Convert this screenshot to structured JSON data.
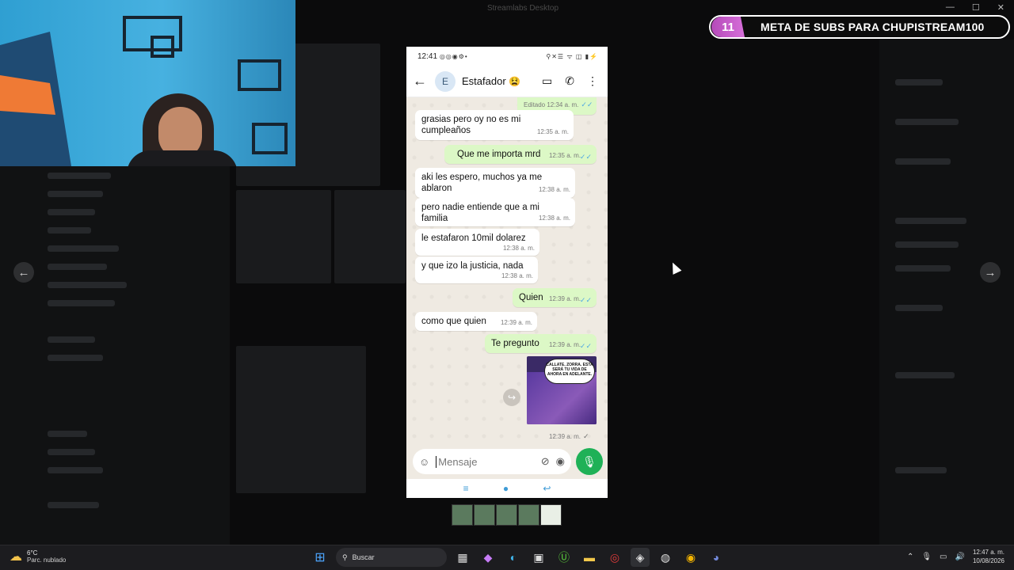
{
  "window": {
    "title": "Streamlabs Desktop",
    "min": "—",
    "max": "☐",
    "close": "✕"
  },
  "overlay": {
    "subs_count": "11",
    "subs_label": "META DE SUBS PARA CHUPISTREAM100"
  },
  "nav": {
    "prev": "←",
    "next": "→"
  },
  "phone": {
    "status": {
      "time": "12:41",
      "left_icons": "◎◎◉⚙•",
      "right_icons": "⚲✕☰ ᯤ ◫ ▮⚡"
    },
    "header": {
      "back": "←",
      "avatar_letter": "E",
      "contact_name": "Estafador",
      "contact_emoji": "😫",
      "video": "▭",
      "call": "✆",
      "menu": "⋮"
    },
    "messages": [
      {
        "dir": "out",
        "text": "",
        "time": "Editado 12:34 a. m.",
        "ticks": "✓✓"
      },
      {
        "dir": "in",
        "text": "grasias pero oy no es mi cumpleaños",
        "time": "12:35 a. m."
      },
      {
        "dir": "out",
        "text": "Que me importa mrd",
        "time": "12:35 a. m.",
        "ticks": "✓✓"
      },
      {
        "dir": "in",
        "text": "aki les espero, muchos ya me ablaron",
        "time": "12:38 a. m."
      },
      {
        "dir": "in",
        "text": "pero nadie entiende que a mi familia",
        "time": "12:38 a. m."
      },
      {
        "dir": "in",
        "text": "le estafaron 10mil dolarez",
        "time": "12:38 a. m."
      },
      {
        "dir": "in",
        "text": "y que izo la justicia, nada",
        "time": "12:38 a. m."
      },
      {
        "dir": "out",
        "text": "Quien",
        "time": "12:39 a. m.",
        "ticks": "✓✓"
      },
      {
        "dir": "in",
        "text": "como que quien",
        "time": "12:39 a. m."
      },
      {
        "dir": "out",
        "text": "Te pregunto",
        "time": "12:39 a. m.",
        "ticks": "✓✓"
      }
    ],
    "image_message": {
      "caption": "CALLATE, ZORRA. ESTA SERÁ TU VIDA DE AHORA EN ADELANTE.",
      "time": "12:39 a. m.",
      "ticks": "✓",
      "forward": "↪"
    },
    "compose": {
      "placeholder": "Mensaje",
      "sticker": "☺",
      "attach": "⊘",
      "camera": "◉",
      "mic": "🎙"
    },
    "navbar": {
      "menu": "≡",
      "home": "●",
      "back": "↩"
    }
  },
  "taskbar": {
    "weather": {
      "icon": "☁",
      "temp": "6°C",
      "condition": "Parc. nublado"
    },
    "start": "⊞",
    "search_icon": "⚲",
    "search_label": "Buscar",
    "apps": [
      "▦",
      "◆",
      "◐",
      "▣",
      "Ⓤ",
      "▬",
      "◎",
      "◈",
      "◍",
      "◉",
      "◕"
    ],
    "tray": {
      "chevron": "⌃",
      "mic": "🎙",
      "network": "▭",
      "volume": "🔊",
      "time": "12:47 a. m.",
      "date": "10/08/2026"
    }
  }
}
